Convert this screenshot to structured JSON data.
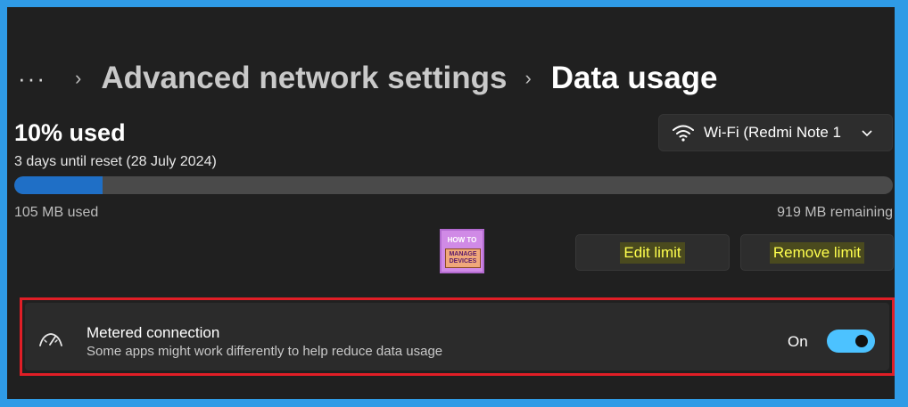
{
  "breadcrumb": {
    "more": "···",
    "separator": "›",
    "parent": "Advanced network settings",
    "current": "Data usage"
  },
  "usage": {
    "percent_label": "10% used",
    "reset_text": "3 days until reset (28 July 2024)",
    "used_label": "105 MB used",
    "remaining_label": "919 MB remaining",
    "fraction_used": 0.1
  },
  "network_selector": {
    "label": "Wi-Fi (Redmi Note 1",
    "icon": "wifi-icon"
  },
  "buttons": {
    "edit": "Edit limit",
    "remove": "Remove limit"
  },
  "logo": {
    "line1": "HOW TO",
    "line2": "MANAGE DEVICES"
  },
  "metered": {
    "title": "Metered connection",
    "description": "Some apps might work differently to help reduce data usage",
    "state_label": "On",
    "enabled": true,
    "icon": "meter-icon"
  },
  "colors": {
    "accent": "#4cc2ff",
    "progress": "#1f6fc6",
    "highlight_text": "#ffff4d",
    "annotation_border": "#e01e26",
    "page_border": "#2f9be6"
  }
}
